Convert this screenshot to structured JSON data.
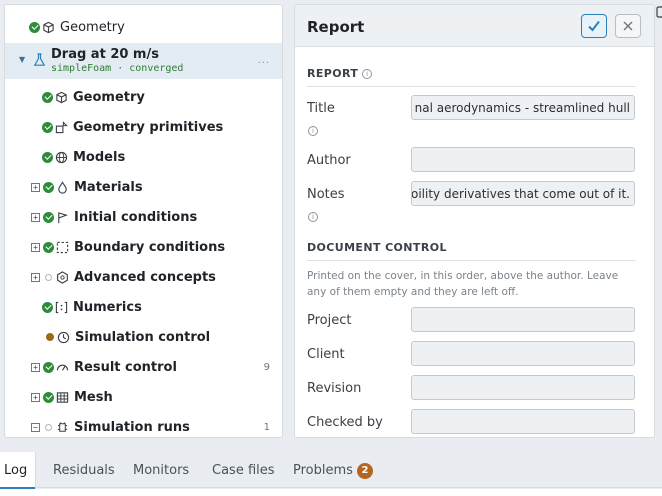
{
  "tree": {
    "top_item": {
      "label": "Geometry"
    },
    "run": {
      "title": "Drag at 20 m/s",
      "subtitle": "simpleFoam · converged",
      "more": "..."
    },
    "items": [
      {
        "label": "Geometry",
        "status": "ok",
        "icon": "cube-icon",
        "expander": ""
      },
      {
        "label": "Geometry primitives",
        "status": "ok",
        "icon": "primitives-icon",
        "expander": ""
      },
      {
        "label": "Models",
        "status": "ok",
        "icon": "globe-icon",
        "expander": ""
      },
      {
        "label": "Materials",
        "status": "ok",
        "icon": "droplet-icon",
        "expander": "+"
      },
      {
        "label": "Initial conditions",
        "status": "ok",
        "icon": "flag-icon",
        "expander": "+"
      },
      {
        "label": "Boundary conditions",
        "status": "ok",
        "icon": "boundary-icon",
        "expander": "+"
      },
      {
        "label": "Advanced concepts",
        "status": "empty",
        "icon": "hexagon-icon",
        "expander": "+"
      },
      {
        "label": "Numerics",
        "status": "ok",
        "icon": "numerics-icon",
        "expander": ""
      },
      {
        "label": "Simulation control",
        "status": "pending",
        "icon": "clock-icon",
        "expander": ""
      },
      {
        "label": "Result control",
        "status": "ok",
        "icon": "gauge-icon",
        "expander": "+",
        "count": "9"
      },
      {
        "label": "Mesh",
        "status": "ok",
        "icon": "grid-icon",
        "expander": "+"
      },
      {
        "label": "Simulation runs",
        "status": "empty",
        "icon": "runs-icon",
        "expander": "−",
        "count": "1"
      }
    ]
  },
  "report": {
    "title": "Report",
    "section_report": "REPORT",
    "section_document_control": "DOCUMENT CONTROL",
    "document_control_help": "Printed on the cover, in this order, above the author. Leave any of them empty and they are left off.",
    "fields": {
      "title": {
        "label": "Title",
        "value": "nal aerodynamics - streamlined hull"
      },
      "author": {
        "label": "Author",
        "value": ""
      },
      "notes": {
        "label": "Notes",
        "value": "oility derivatives that come out of it."
      },
      "project": {
        "label": "Project",
        "value": ""
      },
      "client": {
        "label": "Client",
        "value": ""
      },
      "revision": {
        "label": "Revision",
        "value": ""
      },
      "checked_by": {
        "label": "Checked by",
        "value": ""
      }
    }
  },
  "bottom_tabs": [
    {
      "label": "Log",
      "active": true
    },
    {
      "label": "Residuals"
    },
    {
      "label": "Monitors"
    },
    {
      "label": "Case files"
    },
    {
      "label": "Problems",
      "badge": "2"
    }
  ],
  "colors": {
    "accent": "#2c7fb8",
    "ok": "#2e8b3a",
    "pending": "#9a6a1a",
    "badge": "#b5651d",
    "converged": "#2e7d32"
  }
}
